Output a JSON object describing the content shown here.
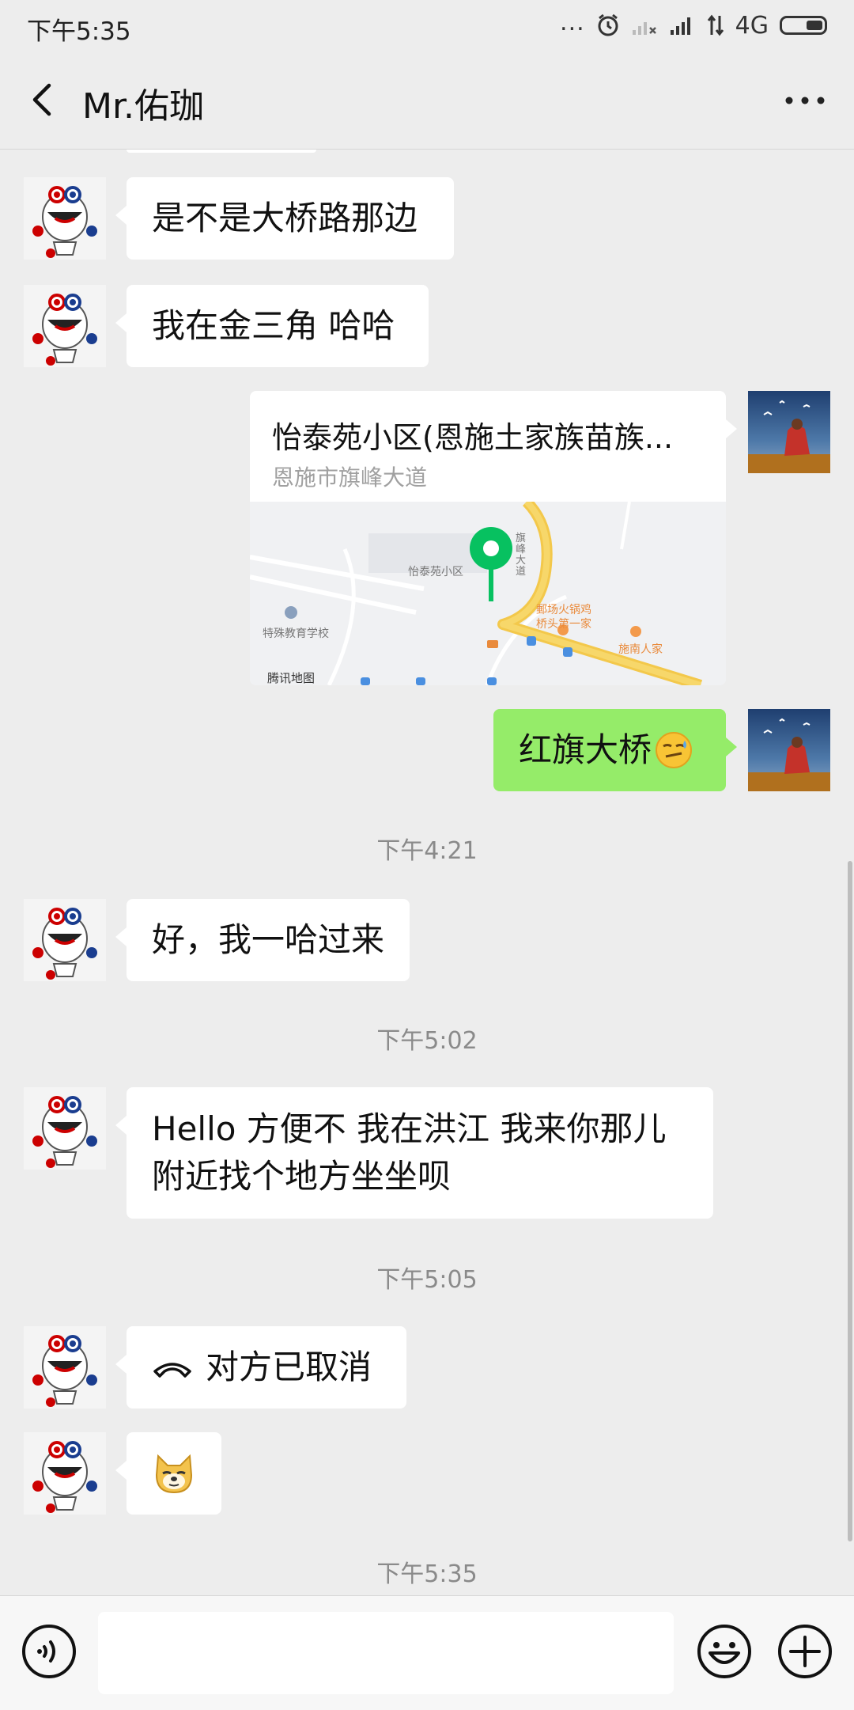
{
  "status_bar": {
    "time": "下午5:35",
    "dots": "...",
    "network": "4G"
  },
  "nav": {
    "title": "Mr.佑珈"
  },
  "messages": [
    {
      "id": "m1",
      "side": "left",
      "text": "是不是大桥路那边"
    },
    {
      "id": "m2",
      "side": "left",
      "text": "我在金三角 哈哈"
    },
    {
      "id": "m3",
      "side": "right",
      "type": "location",
      "name": "怡泰苑小区(恩施土家族苗族...",
      "address": "恩施市旗峰大道",
      "map_labels": {
        "poi": "怡泰苑小区",
        "road": "旗峰大道",
        "school": "特殊教育学校",
        "restaurant1": "郵场火锅鸡",
        "restaurant1b": "桥头第一家",
        "restaurant2": "施南人家",
        "brand": "腾讯地图"
      }
    },
    {
      "id": "m4",
      "side": "right",
      "text": "红旗大桥"
    },
    {
      "id": "m5",
      "side": "left",
      "text": "好，我一哈过来"
    },
    {
      "id": "m6",
      "side": "left",
      "text_line1": "Hello 方便不 我在洪江 我来你那儿",
      "text_line2": "附近找个地方坐坐呗"
    },
    {
      "id": "m7",
      "side": "left",
      "type": "call",
      "text": "对方已取消"
    },
    {
      "id": "m8",
      "side": "left",
      "type": "sticker"
    }
  ],
  "timestamps": {
    "t1": "下午4:21",
    "t2": "下午5:02",
    "t3": "下午5:05",
    "t4": "下午5:35"
  },
  "input": {
    "value": "",
    "placeholder": ""
  },
  "colors": {
    "background": "#ededed",
    "bubble_self": "#95ec69",
    "bubble_other": "#ffffff",
    "map_pin": "#07c160"
  }
}
